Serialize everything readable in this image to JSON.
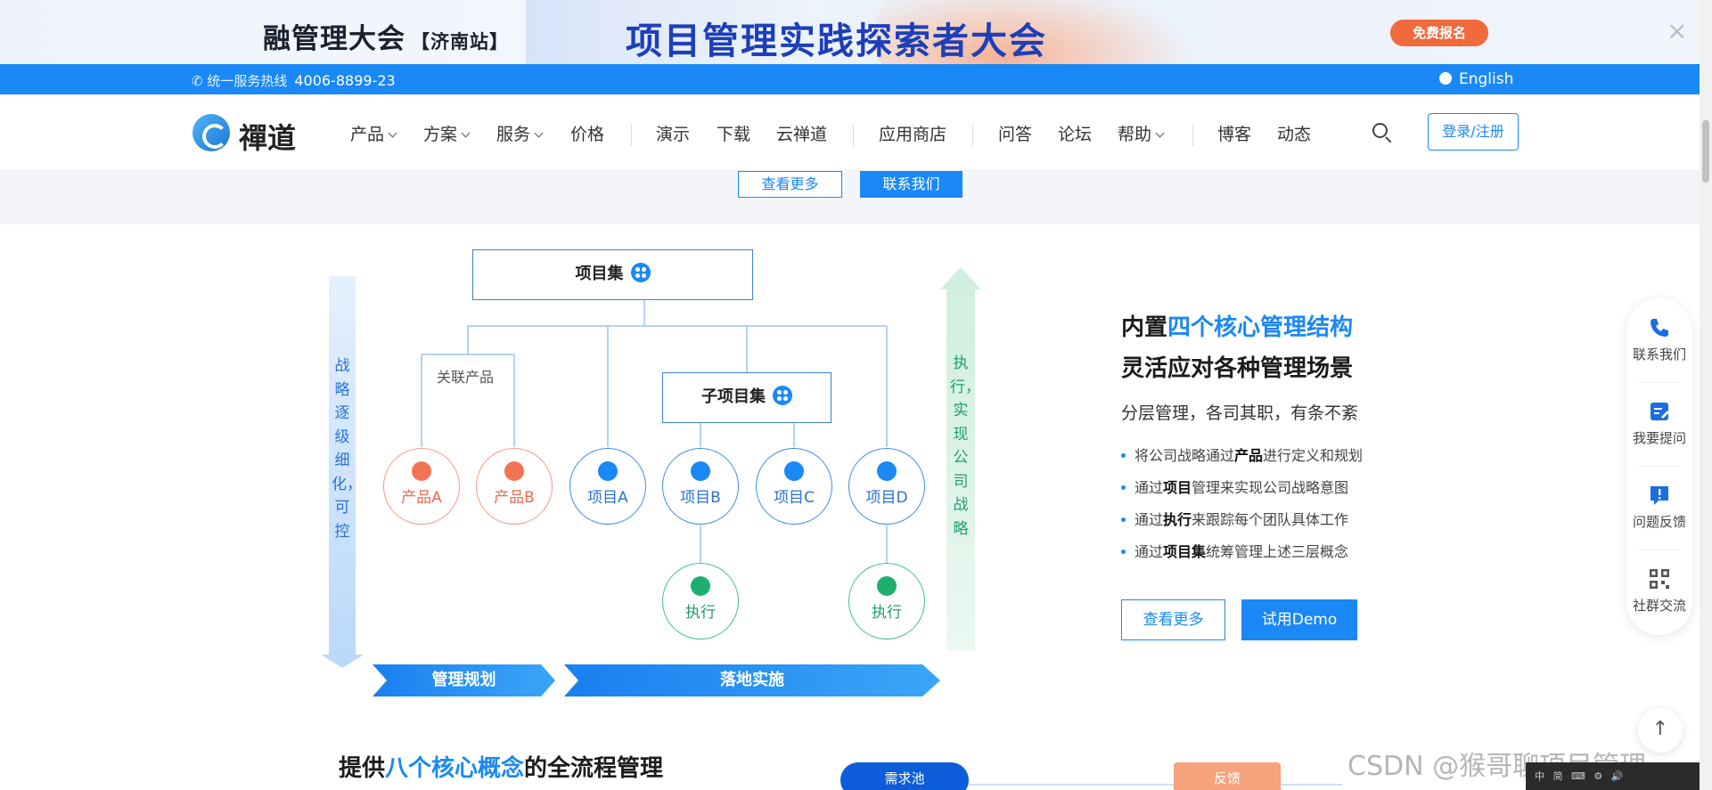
{
  "banner": {
    "title_left": "融管理大会",
    "title_left_sub": "【济南站】",
    "title_main": "项目管理实践探索者大会",
    "signup": "免费报名",
    "close": "×"
  },
  "topbar": {
    "hotline_label": "统一服务热线",
    "hotline_number": "4006-8899-23",
    "language": "English"
  },
  "nav": {
    "logo_text": "禪道",
    "items": [
      {
        "label": "产品",
        "caret": true
      },
      {
        "label": "方案",
        "caret": true
      },
      {
        "label": "服务",
        "caret": true
      },
      {
        "label": "价格",
        "caret": false
      },
      {
        "label": "演示",
        "caret": false
      },
      {
        "label": "下载",
        "caret": false
      },
      {
        "label": "云禅道",
        "caret": false
      },
      {
        "label": "应用商店",
        "caret": false
      },
      {
        "label": "问答",
        "caret": false
      },
      {
        "label": "论坛",
        "caret": false
      },
      {
        "label": "帮助",
        "caret": true
      },
      {
        "label": "博客",
        "caret": false
      },
      {
        "label": "动态",
        "caret": false
      }
    ],
    "login": "登录/注册"
  },
  "band": {
    "more": "查看更多",
    "contact": "联系我们"
  },
  "diagram": {
    "program_set": "项目集",
    "related_products": "关联产品",
    "sub_program_set": "子项目集",
    "products": [
      "产品A",
      "产品B"
    ],
    "projects": [
      "项目A",
      "项目B",
      "项目C",
      "项目D"
    ],
    "execute": "执行",
    "left_vertical": "战略逐级细化，可控",
    "right_vertical": "执行，实现公司战略",
    "plan_bar": "管理规划",
    "implement_bar": "落地实施"
  },
  "feature": {
    "heading_prefix": "内置",
    "heading_highlight": "四个核心管理结构",
    "heading_line2": "灵活应对各种管理场景",
    "subheading": "分层管理，各司其职，有条不紊",
    "bullets": [
      {
        "pre": "将公司战略通过",
        "bold": "产品",
        "post": "进行定义和规划"
      },
      {
        "pre": "通过",
        "bold": "项目",
        "post": "管理来实现公司战略意图"
      },
      {
        "pre": "通过",
        "bold": "执行",
        "post": "来跟踪每个团队具体工作"
      },
      {
        "pre": "通过",
        "bold": "项目集",
        "post": "统筹管理上述三层概念"
      }
    ],
    "more": "查看更多",
    "demo": "试用Demo"
  },
  "section2": {
    "title_prefix": "提供",
    "title_highlight": "八个核心概念",
    "title_suffix": "的全流程管理",
    "pill_left": "需求池",
    "pill_right": "反馈"
  },
  "float_bar": {
    "items": [
      "联系我们",
      "我要提问",
      "问题反馈",
      "社群交流"
    ],
    "to_top": "↑"
  },
  "watermark": "CSDN @猴哥聊项目管理",
  "taskbar": "中 简 ⌨ ⚙ 🔊"
}
